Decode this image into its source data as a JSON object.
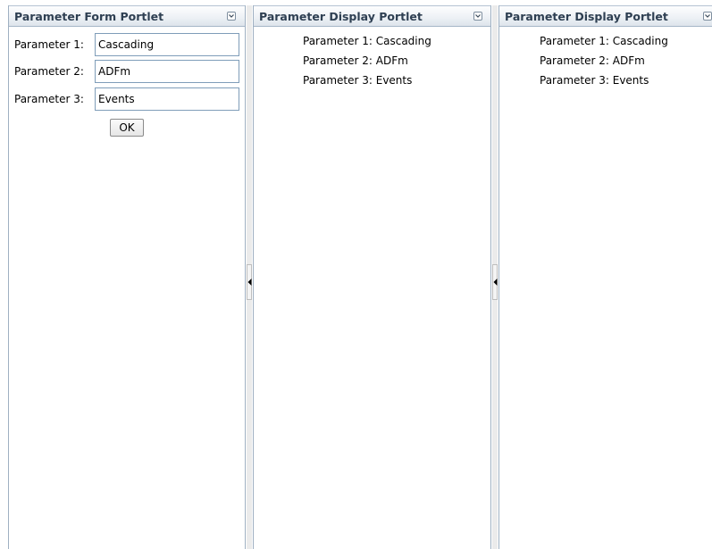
{
  "portlets": {
    "form": {
      "title": "Parameter Form Portlet",
      "menu_icon": "chevron-down-in-box-icon",
      "fields": [
        {
          "label": "Parameter 1:",
          "value": "Cascading"
        },
        {
          "label": "Parameter 2:",
          "value": "ADFm"
        },
        {
          "label": "Parameter 3:",
          "value": "Events"
        }
      ],
      "ok_label": "OK"
    },
    "display1": {
      "title": "Parameter Display Portlet",
      "menu_icon": "chevron-down-in-box-icon",
      "lines": [
        "Parameter 1: Cascading",
        "Parameter 2: ADFm",
        "Parameter 3: Events"
      ]
    },
    "display2": {
      "title": "Parameter Display Portlet",
      "menu_icon": "chevron-down-in-box-icon",
      "lines": [
        "Parameter 1: Cascading",
        "Parameter 2: ADFm",
        "Parameter 3: Events"
      ]
    }
  },
  "splitters": {
    "collapse_icon": "triangle-left-icon"
  },
  "colors": {
    "header_text": "#2e3f52",
    "border": "#9fb0c2",
    "input_border": "#7f9db9"
  }
}
